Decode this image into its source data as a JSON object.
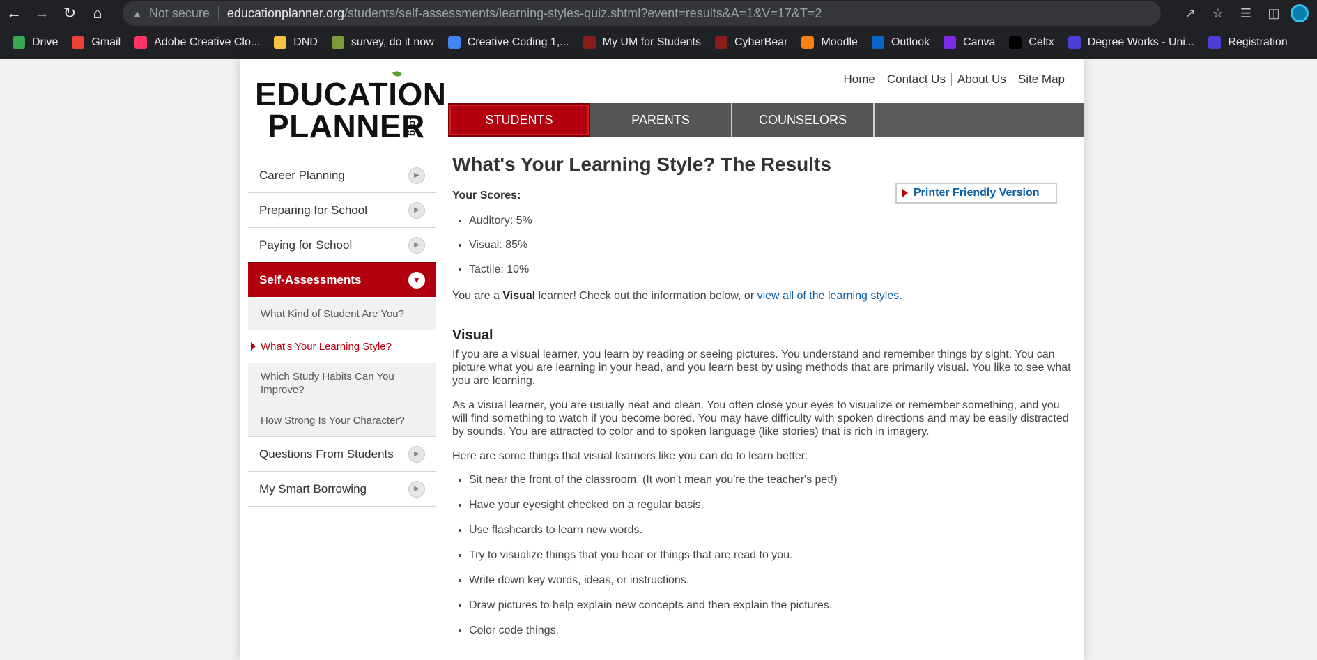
{
  "browser": {
    "security": "Not secure",
    "url_domain": "educationplanner.org",
    "url_path": "/students/self-assessments/learning-styles-quiz.shtml?event=results&A=1&V=17&T=2"
  },
  "bookmarks": [
    {
      "label": "Drive",
      "icon": "drive-icon",
      "color": "#34a853"
    },
    {
      "label": "Gmail",
      "icon": "gmail-icon",
      "color": "#ea4335"
    },
    {
      "label": "Adobe Creative Clo...",
      "icon": "adobe-icon",
      "color": "#ff3366"
    },
    {
      "label": "DND",
      "icon": "folder-icon",
      "color": "#f6c344"
    },
    {
      "label": "survey, do it now",
      "icon": "survey-icon",
      "color": "#7d9a3b"
    },
    {
      "label": "Creative Coding 1,...",
      "icon": "drive-icon",
      "color": "#4285f4"
    },
    {
      "label": "My UM for Students",
      "icon": "um-icon",
      "color": "#8b1c1c"
    },
    {
      "label": "CyberBear",
      "icon": "cyberbear-icon",
      "color": "#8b1c1c"
    },
    {
      "label": "Moodle",
      "icon": "moodle-icon",
      "color": "#f98012"
    },
    {
      "label": "Outlook",
      "icon": "outlook-icon",
      "color": "#0a64c9"
    },
    {
      "label": "Canva",
      "icon": "canva-icon",
      "color": "#7d2ae8"
    },
    {
      "label": "Celtx",
      "icon": "celtx-icon",
      "color": "#000000"
    },
    {
      "label": "Degree Works - Uni...",
      "icon": "degreeworks-icon",
      "color": "#4b3fd6"
    },
    {
      "label": "Registration",
      "icon": "registration-icon",
      "color": "#4b3fd6"
    }
  ],
  "logo": {
    "line1": "EDUCATION",
    "line2": "PLANNER",
    "suffix": ".org"
  },
  "util_nav": [
    "Home",
    "Contact Us",
    "About Us",
    "Site Map"
  ],
  "tabs": [
    {
      "label": "STUDENTS",
      "active": true
    },
    {
      "label": "PARENTS",
      "active": false
    },
    {
      "label": "COUNSELORS",
      "active": false
    }
  ],
  "sidebar": {
    "top_items": [
      "Career Planning",
      "Preparing for School",
      "Paying for School"
    ],
    "active_item": "Self-Assessments",
    "sub_items": [
      "What Kind of Student Are You?",
      "What's Your Learning Style?",
      "Which Study Habits Can You Improve?",
      "How Strong Is Your Character?"
    ],
    "current_sub": "What's Your Learning Style?",
    "bottom_items": [
      "Questions From Students",
      "My Smart Borrowing"
    ]
  },
  "main": {
    "title": "What's Your Learning Style? The Results",
    "scores_label": "Your Scores:",
    "printer_label": "Printer Friendly Version",
    "scores": [
      "Auditory: 5%",
      "Visual: 85%",
      "Tactile: 10%"
    ],
    "result_prefix": "You are a ",
    "result_style": "Visual",
    "result_mid": " learner! Check out the information below, or ",
    "result_link": "view all of the learning styles",
    "result_end": ".",
    "section_title": "Visual",
    "para1": "If you are a visual learner, you learn by reading or seeing pictures. You understand and remember things by sight. You can picture what you are learning in your head, and you learn best by using methods that are primarily visual. You like to see what you are learning.",
    "para2": "As a visual learner, you are usually neat and clean. You often close your eyes to visualize or remember something, and you will find something to watch if you become bored. You may have difficulty with spoken directions and may be easily distracted by sounds. You are attracted to color and to spoken language (like stories) that is rich in imagery.",
    "para3": "Here are some things that visual learners like you can do to learn better:",
    "tips": [
      "Sit near the front of the classroom. (It won't mean you're the teacher's pet!)",
      "Have your eyesight checked on a regular basis.",
      "Use flashcards to learn new words.",
      "Try to visualize things that you hear or things that are read to you.",
      "Write down key words, ideas, or instructions.",
      "Draw pictures to help explain new concepts and then explain the pictures.",
      "Color code things."
    ]
  }
}
